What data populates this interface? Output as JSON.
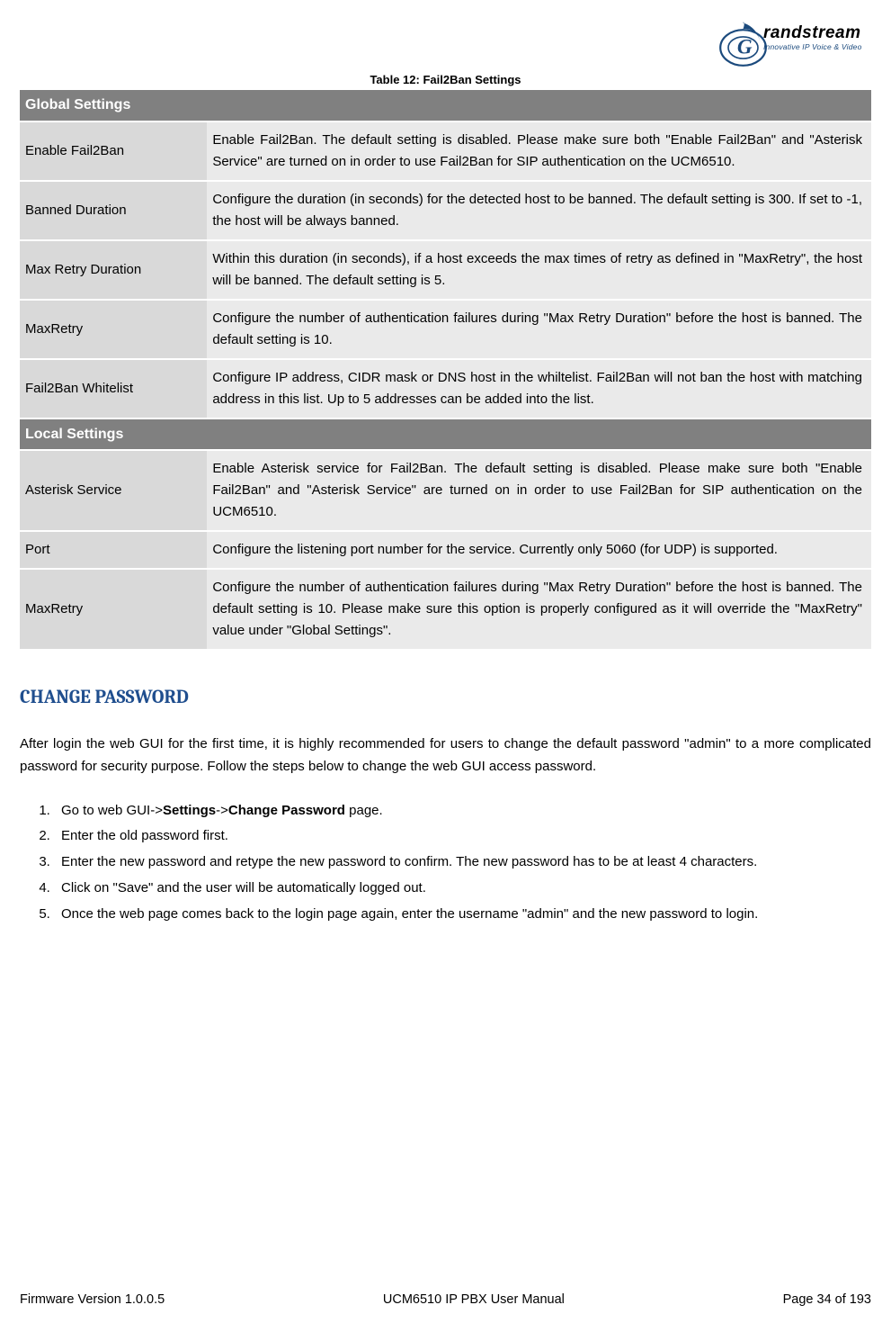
{
  "logo": {
    "brand": "randstream",
    "tagline": "Innovative IP Voice & Video"
  },
  "table_caption": "Table 12: Fail2Ban Settings",
  "sections": [
    {
      "header": "Global Settings",
      "rows": [
        {
          "label": "Enable Fail2Ban",
          "desc": "Enable Fail2Ban. The default setting is disabled. Please make sure both \"Enable Fail2Ban\" and \"Asterisk Service\" are turned on in order to use Fail2Ban for SIP authentication on the UCM6510."
        },
        {
          "label": "Banned Duration",
          "desc": "Configure the duration (in seconds) for the detected host to be banned. The default setting is 300. If set to -1, the host will be always banned."
        },
        {
          "label": "Max Retry Duration",
          "desc": "Within this duration (in seconds), if a host exceeds the max times of retry as defined in \"MaxRetry\", the host will be banned. The default setting is 5."
        },
        {
          "label": "MaxRetry",
          "desc": "Configure the number of authentication failures during \"Max Retry Duration\" before the host is banned. The default setting is 10."
        },
        {
          "label": "Fail2Ban Whitelist",
          "desc": "Configure IP address, CIDR mask or DNS host in the whiltelist. Fail2Ban will not ban the host with matching address in this list. Up to 5 addresses can be added into the list."
        }
      ]
    },
    {
      "header": "Local Settings",
      "rows": [
        {
          "label": "Asterisk Service",
          "desc": "Enable Asterisk service for Fail2Ban. The default setting is disabled. Please make sure both \"Enable Fail2Ban\" and \"Asterisk Service\" are turned on in order to use Fail2Ban for SIP authentication on the UCM6510."
        },
        {
          "label": "Port",
          "desc": "Configure the listening port number for the service. Currently only 5060 (for UDP) is supported."
        },
        {
          "label": "MaxRetry",
          "desc": "Configure the number of authentication failures during \"Max Retry Duration\" before the host is banned. The default setting is 10. Please make sure this option is properly configured as it will override the \"MaxRetry\" value under \"Global Settings\"."
        }
      ]
    }
  ],
  "heading": "CHANGE PASSWORD",
  "intro_para": "After login the web GUI for the first time, it is highly recommended for users to change the default password \"admin\" to a more complicated password for security purpose. Follow the steps below to change the web GUI access password.",
  "steps": {
    "s1_pre": "Go to web GUI->",
    "s1_b1": "Settings",
    "s1_mid": "->",
    "s1_b2": "Change Password",
    "s1_post": " page.",
    "s2": "Enter the old password first.",
    "s3": "Enter the new password and retype the new password to confirm. The new password has to be at least 4 characters.",
    "s4": "Click on \"Save\" and the user will be automatically logged out.",
    "s5": "Once the web page comes back to the login page again, enter the username \"admin\" and the new password to login."
  },
  "footer": {
    "left": "Firmware Version 1.0.0.5",
    "center": "UCM6510 IP PBX User Manual",
    "right": "Page 34 of 193"
  }
}
